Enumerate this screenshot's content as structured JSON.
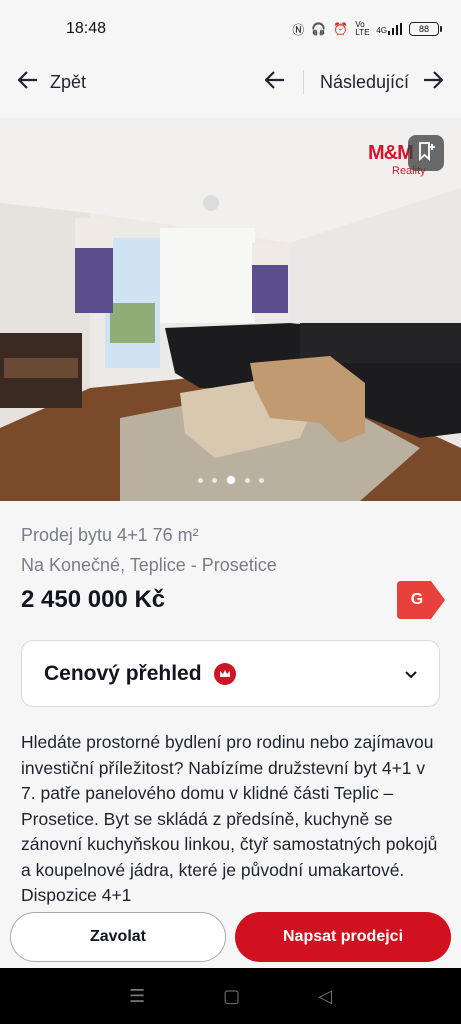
{
  "status_bar": {
    "time": "18:48",
    "network": "4G",
    "volte": "Vo LTE",
    "battery": "88"
  },
  "nav": {
    "back_label": "Zpět",
    "next_label": "Následující"
  },
  "gallery": {
    "logo_text": "M&M",
    "logo_sub": "Reality",
    "slide_count": 5,
    "active_slide": 3
  },
  "listing": {
    "title": "Prodej bytu 4+1 76 m²",
    "address": "Na Konečné, Teplice - Prosetice",
    "price": "2 450 000 Kč",
    "energy_class": "G",
    "energy_color": "#e8413c"
  },
  "price_overview": {
    "label": "Cenový přehled"
  },
  "description": "Hledáte prostorné bydlení pro rodinu nebo zajímavou investiční příležitost? Nabízíme družstevní byt 4+1 v 7. patře panelového domu v klidné části Teplic – Prosetice. Byt se skládá z předsíně, kuchyně se zánovní kuchyňskou linkou, čtyř samostatných pokojů a koupelnové jádra, které je původní umakartové. Dispozice 4+1",
  "actions": {
    "call_label": "Zavolat",
    "message_label": "Napsat prodejci"
  },
  "colors": {
    "brand_red": "#d0111f"
  }
}
